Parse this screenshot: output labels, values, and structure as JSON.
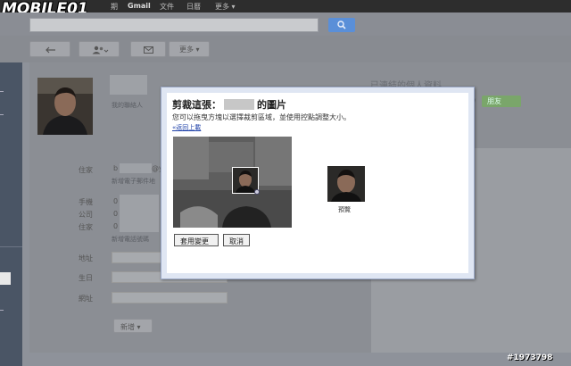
{
  "brand": {
    "logo_text": "MOBILE01"
  },
  "topnav": {
    "items": [
      "Gmail",
      "文件",
      "日曆",
      "更多 ▾"
    ],
    "partial_item": "期"
  },
  "toolbar": {
    "more_label": "更多 ▾"
  },
  "contact": {
    "my_contacts_label": "我的聯絡人",
    "labels": {
      "home": "住家",
      "mobile": "手機",
      "work": "公司",
      "home2": "住家",
      "address": "地址",
      "birthday": "生日",
      "website": "網址"
    },
    "email_partial": "b",
    "email_tail": "@y",
    "phone_prefix_1": "0",
    "phone_prefix_2": "0",
    "phone_prefix_3": "0",
    "add_email_link": "新增電子郵件地",
    "add_phone_link": "新增電話號碼",
    "add_button": "新增 ▾",
    "connected_title": "已連結的個人資料",
    "connected_tail": "w",
    "friend_badge": "朋友"
  },
  "dialog": {
    "title_prefix": "剪裁這張：",
    "title_suffix": "的圖片",
    "description": "您可以拖曳方塊以選擇裁剪區域，並使用控點調整大小。",
    "back_link": "«返回上載",
    "preview_label": "預覽",
    "apply_button": "套用變更",
    "cancel_button": "取消"
  },
  "watermark": "#1973798",
  "colors": {
    "accent_blue": "#5a8fd8",
    "friend_green": "#7aa66a",
    "dialog_border": "#9aa8c6"
  }
}
